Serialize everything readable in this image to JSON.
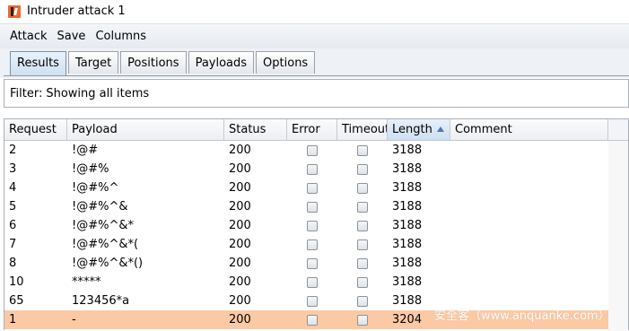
{
  "window": {
    "title": "Intruder attack 1"
  },
  "menu": [
    "Attack",
    "Save",
    "Columns"
  ],
  "tabs": [
    {
      "label": "Results",
      "active": true
    },
    {
      "label": "Target",
      "active": false
    },
    {
      "label": "Positions",
      "active": false
    },
    {
      "label": "Payloads",
      "active": false
    },
    {
      "label": "Options",
      "active": false
    }
  ],
  "filter": {
    "label": "Filter:",
    "value": "Showing all items"
  },
  "table": {
    "columns": [
      "Request",
      "Payload",
      "Status",
      "Error",
      "Timeout",
      "Length",
      "Comment"
    ],
    "sorted_column": "Length",
    "sort_direction": "ascending",
    "rows": [
      {
        "request": "2",
        "payload": "!@#",
        "status": "200",
        "error": false,
        "timeout": false,
        "length": "3188",
        "comment": ""
      },
      {
        "request": "3",
        "payload": "!@#%",
        "status": "200",
        "error": false,
        "timeout": false,
        "length": "3188",
        "comment": ""
      },
      {
        "request": "4",
        "payload": "!@#%^",
        "status": "200",
        "error": false,
        "timeout": false,
        "length": "3188",
        "comment": ""
      },
      {
        "request": "5",
        "payload": "!@#%^&",
        "status": "200",
        "error": false,
        "timeout": false,
        "length": "3188",
        "comment": ""
      },
      {
        "request": "6",
        "payload": "!@#%^&*",
        "status": "200",
        "error": false,
        "timeout": false,
        "length": "3188",
        "comment": ""
      },
      {
        "request": "7",
        "payload": "!@#%^&*(",
        "status": "200",
        "error": false,
        "timeout": false,
        "length": "3188",
        "comment": ""
      },
      {
        "request": "8",
        "payload": "!@#%^&*()",
        "status": "200",
        "error": false,
        "timeout": false,
        "length": "3188",
        "comment": ""
      },
      {
        "request": "10",
        "payload": "*****",
        "status": "200",
        "error": false,
        "timeout": false,
        "length": "3188",
        "comment": ""
      },
      {
        "request": "65",
        "payload": "123456*a",
        "status": "200",
        "error": false,
        "timeout": false,
        "length": "3188",
        "comment": ""
      },
      {
        "request": "1",
        "payload": "-",
        "status": "200",
        "error": false,
        "timeout": false,
        "length": "3204",
        "comment": "",
        "highlighted": true
      }
    ]
  },
  "colors": {
    "highlight_row": "#fbc9a3",
    "accent": "#e8682f"
  },
  "watermark": "安全客（www.anquanke.com）"
}
